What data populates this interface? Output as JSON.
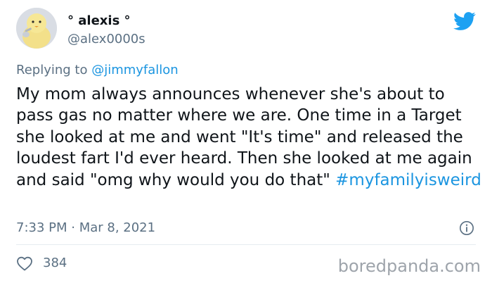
{
  "tweet": {
    "author": {
      "display_name": "° alexis °",
      "handle": "@alex0000s"
    },
    "reply_prefix": "Replying to ",
    "reply_to": "@jimmyfallon",
    "text": "My mom always announces whenever she's about to pass gas no matter where we are. One time in a Target she looked at me and went \"It's time\" and released the loudest fart I'd ever heard. Then she looked at me again and said \"omg why would you do that\" ",
    "hashtag": "#myfamilyisweird",
    "time": "7:33 PM",
    "separator": " · ",
    "date": "Mar 8, 2021",
    "likes": "384"
  },
  "watermark": "boredpanda.com",
  "colors": {
    "link": "#1b95e0",
    "muted": "#5b7083",
    "twitter_blue": "#1da1f2"
  },
  "icons": {
    "bird": "twitter-bird-icon",
    "info": "info-icon",
    "like": "heart-icon"
  }
}
